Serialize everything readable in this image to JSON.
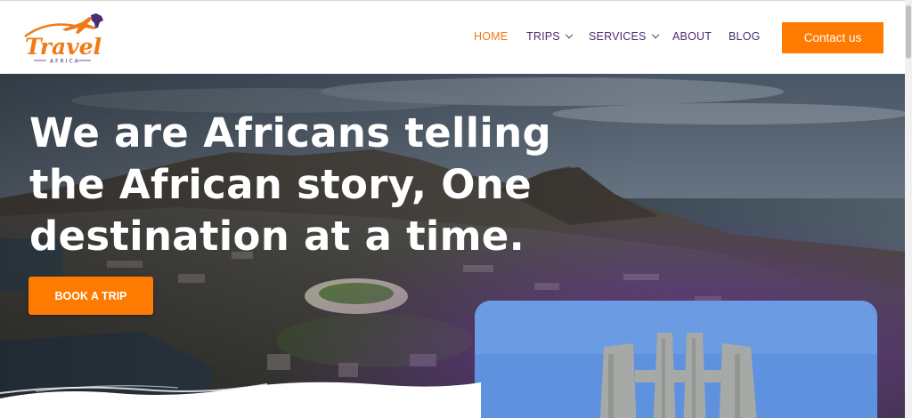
{
  "brand": {
    "name": "Travel",
    "tagline": "AFRICA",
    "colors": {
      "accent": "#ff7a00",
      "nav_text": "#4a2e73",
      "nav_active": "#f07a15"
    }
  },
  "nav": {
    "items": [
      {
        "label": "HOME",
        "active": true,
        "dropdown": false
      },
      {
        "label": "TRIPS",
        "active": false,
        "dropdown": true
      },
      {
        "label": "SERVICES",
        "active": false,
        "dropdown": true
      },
      {
        "label": "ABOUT",
        "active": false,
        "dropdown": false
      },
      {
        "label": "BLOG",
        "active": false,
        "dropdown": false
      }
    ],
    "contact_label": "Contact us"
  },
  "hero": {
    "headline_lines": [
      "We are Africans telling",
      "the African story, One",
      "destination at a time."
    ],
    "cta_label": "BOOK A TRIP"
  }
}
